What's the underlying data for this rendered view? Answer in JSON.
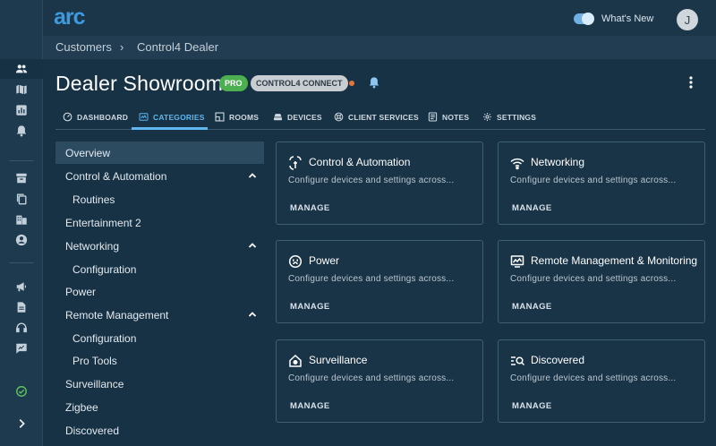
{
  "brand": {
    "logo_text": "arc"
  },
  "topbar": {
    "whats_new": "What's New",
    "avatar_initial": "J"
  },
  "breadcrumb": {
    "items": [
      "Customers",
      "Control4 Dealer"
    ],
    "separator": "›"
  },
  "header": {
    "title": "Dealer Showroom",
    "badge_pro": "PRO",
    "badge_connect": "CONTROL4 CONNECT"
  },
  "tabs": [
    {
      "label": "DASHBOARD",
      "icon": "gauge-icon"
    },
    {
      "label": "CATEGORIES",
      "icon": "categories-icon",
      "active": true
    },
    {
      "label": "ROOMS",
      "icon": "rooms-icon"
    },
    {
      "label": "DEVICES",
      "icon": "devices-icon"
    },
    {
      "label": "CLIENT SERVICES",
      "icon": "client-services-icon"
    },
    {
      "label": "NOTES",
      "icon": "notes-icon"
    },
    {
      "label": "SETTINGS",
      "icon": "gear-icon"
    }
  ],
  "nav": [
    {
      "label": "Overview",
      "selected": true
    },
    {
      "label": "Control & Automation",
      "expandable": true
    },
    {
      "label": "Routines",
      "sub": true
    },
    {
      "label": "Entertainment 2"
    },
    {
      "label": "Networking",
      "expandable": true
    },
    {
      "label": "Configuration",
      "sub": true
    },
    {
      "label": "Power"
    },
    {
      "label": "Remote Management",
      "expandable": true
    },
    {
      "label": "Configuration",
      "sub": true
    },
    {
      "label": "Pro Tools",
      "sub": true
    },
    {
      "label": "Surveillance"
    },
    {
      "label": "Zigbee"
    },
    {
      "label": "Discovered"
    }
  ],
  "cards": [
    {
      "title": "Control & Automation",
      "desc": "Configure devices and settings across...",
      "action": "MANAGE",
      "icon": "automation-icon"
    },
    {
      "title": "Networking",
      "desc": "Configure devices and settings across...",
      "action": "MANAGE",
      "icon": "wifi-icon"
    },
    {
      "title": "Power",
      "desc": "Configure devices and settings across...",
      "action": "MANAGE",
      "icon": "power-outlet-icon"
    },
    {
      "title": "Remote Management & Monitoring",
      "desc": "Configure devices and settings across...",
      "action": "MANAGE",
      "icon": "monitor-icon"
    },
    {
      "title": "Surveillance",
      "desc": "Configure devices and settings across...",
      "action": "MANAGE",
      "icon": "home-security-icon"
    },
    {
      "title": "Discovered",
      "desc": "Configure devices and settings across...",
      "action": "MANAGE",
      "icon": "discover-icon"
    }
  ],
  "colors": {
    "accent": "#5fb6f0",
    "pro": "#4caf50",
    "status": "#e8743b",
    "background": "#183245"
  }
}
